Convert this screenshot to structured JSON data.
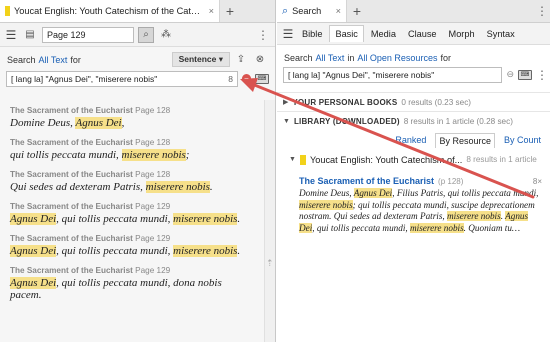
{
  "left": {
    "tab_title": "Youcat English: Youth Catechism of the Catholic Church",
    "reference": "Page 129",
    "search_all_label": "Search",
    "search_all_link": "All Text",
    "search_all_for": "for",
    "scope": "Sentence",
    "query": "[ lang la] \"Agnus Dei\",  \"miserere nobis\"",
    "count": "8",
    "results": [
      {
        "title": "The Sacrament of the Eucharist",
        "page": "Page 128",
        "parts": [
          {
            "t": "Domine Deus, ",
            "h": false
          },
          {
            "t": "Agnus Dei",
            "h": true
          },
          {
            "t": ",",
            "h": false
          }
        ]
      },
      {
        "title": "The Sacrament of the Eucharist",
        "page": "Page 128",
        "parts": [
          {
            "t": "qui tollis peccata mundi, ",
            "h": false
          },
          {
            "t": "miserere nobis",
            "h": true
          },
          {
            "t": ";",
            "h": false
          }
        ]
      },
      {
        "title": "The Sacrament of the Eucharist",
        "page": "Page 128",
        "parts": [
          {
            "t": "Qui sedes ad dexteram Patris, ",
            "h": false
          },
          {
            "t": "miserere nobis",
            "h": true
          },
          {
            "t": ".",
            "h": false
          }
        ]
      },
      {
        "title": "The Sacrament of the Eucharist",
        "page": "Page 129",
        "parts": [
          {
            "t": "Agnus Dei",
            "h": true
          },
          {
            "t": ", qui tollis peccata mundi, ",
            "h": false
          },
          {
            "t": "miserere nobis",
            "h": true
          },
          {
            "t": ".",
            "h": false
          }
        ]
      },
      {
        "title": "The Sacrament of the Eucharist",
        "page": "Page 129",
        "parts": [
          {
            "t": "Agnus Dei",
            "h": true
          },
          {
            "t": ", qui tollis peccata mundi, ",
            "h": false
          },
          {
            "t": "miserere nobis",
            "h": true
          },
          {
            "t": ".",
            "h": false
          }
        ]
      },
      {
        "title": "The Sacrament of the Eucharist",
        "page": "Page 129",
        "parts": [
          {
            "t": "Agnus Dei",
            "h": true
          },
          {
            "t": ", qui tollis peccata mundi, dona nobis pacem.",
            "h": false
          }
        ]
      }
    ]
  },
  "right": {
    "tab_title": "Search",
    "tabs": [
      "Bible",
      "Basic",
      "Media",
      "Clause",
      "Morph",
      "Syntax"
    ],
    "active_tab": "Basic",
    "search_label": "Search",
    "search_all": "All Text",
    "search_in": "in",
    "resources": "All Open Resources",
    "search_for": "for",
    "query": "[ lang la] \"Agnus Dei\",  \"miserere nobis\"",
    "personal_books": "YOUR PERSONAL BOOKS",
    "personal_count": "0 results (0.23 sec)",
    "library": "LIBRARY (DOWNLOADED)",
    "library_count": "8 results in 1 article (0.28 sec)",
    "views": [
      "Ranked",
      "By Resource",
      "By Count"
    ],
    "selected_view": "By Resource",
    "book_title": "Youcat English: Youth Catechism of...",
    "book_count": "8 results in 1 article",
    "hit_title": "The Sacrament of the Eucharist",
    "hit_page": "(p 128)",
    "hit_count": "8×",
    "hit_parts": [
      {
        "t": "Domine Deus, ",
        "h": false
      },
      {
        "t": "Agnus Dei",
        "h": true
      },
      {
        "t": ", Filius Patris, qui tollis peccata mundi, ",
        "h": false
      },
      {
        "t": "miserere nobis",
        "h": true
      },
      {
        "t": "; qui tollis peccata mundi, suscipe deprecationem nostram. Qui sedes ad dexteram Patris, ",
        "h": false
      },
      {
        "t": "miserere nobis",
        "h": true
      },
      {
        "t": ". ",
        "h": false
      },
      {
        "t": "Agnus Dei",
        "h": true
      },
      {
        "t": ", qui tollis peccata mundi, ",
        "h": false
      },
      {
        "t": "miserere nobis",
        "h": true
      },
      {
        "t": ". Quoniam tu…",
        "h": false
      }
    ]
  },
  "colors": {
    "highlight": "#f6e08a",
    "accent": "#1a5fb4",
    "arrow": "#d9534f"
  }
}
